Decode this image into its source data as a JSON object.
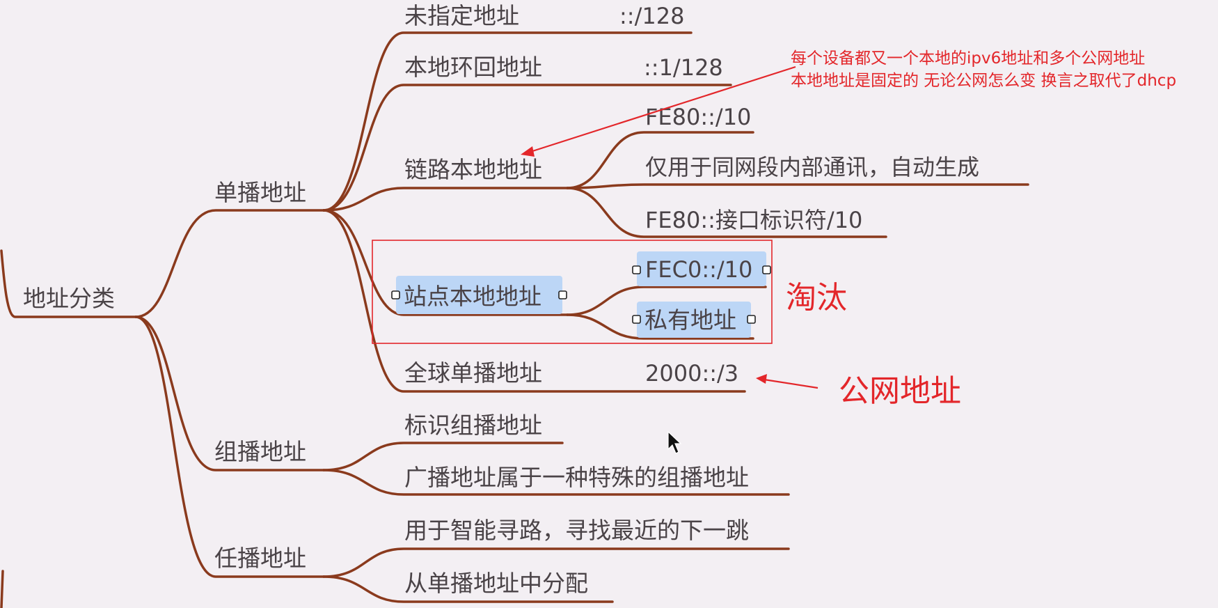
{
  "root": "地址分类",
  "branches": {
    "unicast": "单播地址",
    "multicast": "组播地址",
    "anycast": "任播地址"
  },
  "unicast_children": {
    "unspecified": {
      "label": "未指定地址",
      "value": "::/128"
    },
    "loopback": {
      "label": "本地环回地址",
      "value": "::1/128"
    },
    "link_local": {
      "label": "链路本地地址",
      "details": [
        "FE80::/10",
        "仅用于同网段内部通讯，自动生成",
        "FE80::接口标识符/10"
      ]
    },
    "site_local": {
      "label": "站点本地地址",
      "details": [
        "FEC0::/10",
        "私有地址"
      ]
    },
    "global_unicast": {
      "label": "全球单播地址",
      "value": "2000::/3"
    }
  },
  "multicast_children": [
    "标识组播地址",
    "广播地址属于一种特殊的组播地址"
  ],
  "anycast_children": [
    "用于智能寻路，寻找最近的下一跳",
    "从单播地址中分配"
  ],
  "annotations": {
    "note_line1": "每个设备都又一个本地的ipv6地址和多个公网地址",
    "note_line2": "本地地址是固定的 无论公网怎么变 换言之取代了dhcp",
    "deprecated": "淘汰",
    "public_address": "公网地址"
  },
  "colors": {
    "branch": "#8a3a1d",
    "text": "#4a4347",
    "annotation": "#e3262a",
    "selection": "#bcd6f6",
    "background": "#f3eff3"
  },
  "icons": [
    "mouse-cursor-icon"
  ]
}
